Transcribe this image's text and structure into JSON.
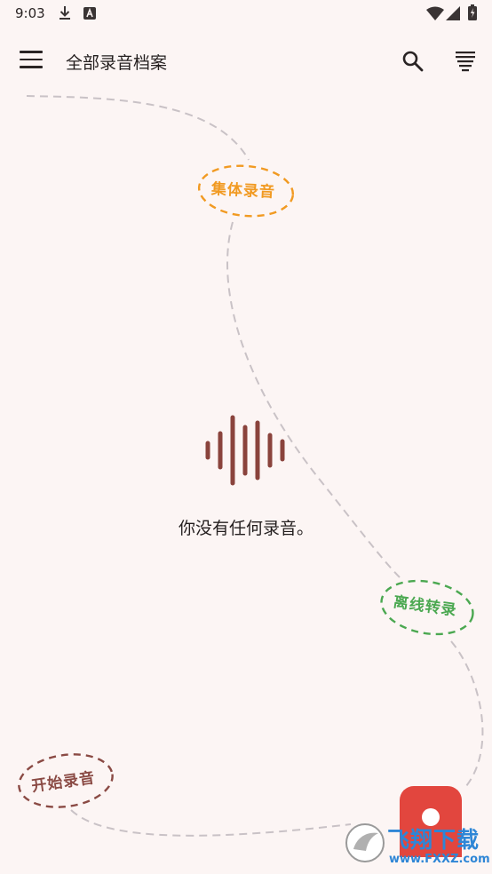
{
  "status_bar": {
    "time": "9:03",
    "left_icons": [
      "download-icon",
      "a-box-icon"
    ],
    "right_icons": [
      "wifi-icon",
      "signal-icon",
      "battery-icon"
    ]
  },
  "app_bar": {
    "title": "全部录音档案",
    "menu_icon": "menu-icon",
    "search_icon": "search-icon",
    "sort_icon": "sort-icon"
  },
  "chips": {
    "group_recording": "集体录音",
    "offline_transcribe": "离线转录",
    "start_recording": "开始录音"
  },
  "empty_state": {
    "icon": "waveform-icon",
    "message": "你没有任何录音。"
  },
  "fab": {
    "icon": "record-icon"
  },
  "watermark": {
    "main": "飞翔下载",
    "sub": "www.FXXZ.com"
  },
  "colors": {
    "background": "#fcf5f4",
    "accent_red": "#e2463e",
    "waveform": "#8a433c",
    "orange": "#f19a22",
    "green": "#4ba851",
    "brown": "#8a4a44",
    "dash": "#c9c2c6"
  }
}
